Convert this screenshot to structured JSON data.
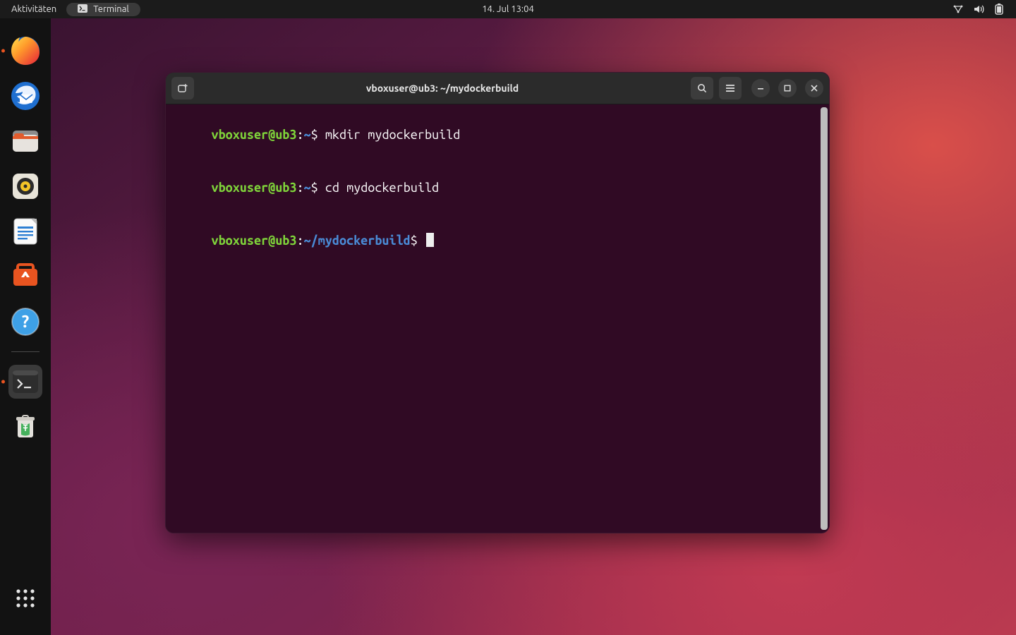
{
  "topbar": {
    "activities_label": "Aktivitäten",
    "active_app_label": "Terminal",
    "datetime": "14. Jul  13:04",
    "status_icons": [
      "network-icon",
      "volume-icon",
      "battery-icon"
    ]
  },
  "dock": {
    "items": [
      {
        "name": "firefox-icon"
      },
      {
        "name": "thunderbird-icon"
      },
      {
        "name": "files-icon"
      },
      {
        "name": "rhythmbox-icon"
      },
      {
        "name": "libreoffice-writer-icon"
      },
      {
        "name": "ubuntu-software-icon"
      },
      {
        "name": "help-icon"
      }
    ],
    "running_items": [
      {
        "name": "terminal-icon"
      }
    ],
    "after_items": [
      {
        "name": "trash-icon"
      }
    ],
    "apps_button_name": "show-applications-icon"
  },
  "terminal": {
    "window_title": "vboxuser@ub3: ~/mydockerbuild",
    "titlebar_buttons": {
      "new_tab": "new-tab-button",
      "search": "search-button",
      "menu": "hamburger-menu-button",
      "minimize": "minimize-button",
      "maximize": "maximize-button",
      "close": "close-button"
    },
    "lines": [
      {
        "user": "vboxuser@ub3",
        "sep": ":",
        "path": "~",
        "prompt": "$",
        "cmd": "mkdir mydockerbuild"
      },
      {
        "user": "vboxuser@ub3",
        "sep": ":",
        "path": "~",
        "prompt": "$",
        "cmd": "cd mydockerbuild"
      },
      {
        "user": "vboxuser@ub3",
        "sep": ":",
        "path": "~/mydockerbuild",
        "prompt": "$",
        "cmd": "",
        "cursor": true
      }
    ]
  }
}
